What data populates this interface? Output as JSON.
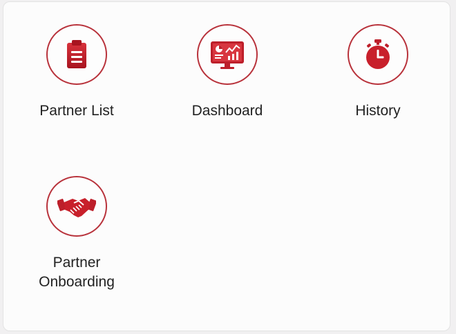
{
  "menu": {
    "accent_color": "#c4252f",
    "items": [
      {
        "label": "Partner List",
        "icon": "clipboard-icon"
      },
      {
        "label": "Dashboard",
        "icon": "monitor-chart-icon"
      },
      {
        "label": "History",
        "icon": "stopwatch-icon"
      },
      {
        "label": "Partner\nOnboarding",
        "icon": "handshake-icon"
      }
    ]
  }
}
